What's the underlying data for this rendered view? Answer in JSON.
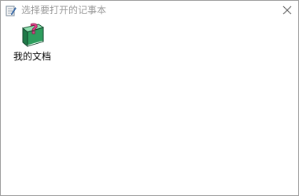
{
  "window": {
    "title": "选择要打开的记事本",
    "app_icon": "notepad-icon",
    "close_icon": "close-icon"
  },
  "files": [
    {
      "label": "我的文档",
      "icon": "help-book-icon"
    }
  ],
  "colors": {
    "title_text": "#999999",
    "border": "#a0a0a0",
    "book_green": "#2e9e5e",
    "question_pink": "#e0408a"
  }
}
